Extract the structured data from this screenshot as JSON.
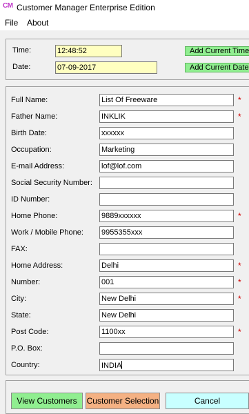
{
  "window": {
    "icon_text": "CM",
    "title": "Customer Manager Enterprise Edition"
  },
  "menu": {
    "file": "File",
    "about": "About"
  },
  "datetime": {
    "time_label": "Time:",
    "time_value": "12:48:52",
    "date_label": "Date:",
    "date_value": "07-09-2017",
    "add_time_button": "Add Current Time",
    "add_date_button": "Add Current Date"
  },
  "form": {
    "fields": [
      {
        "label": "Full Name:",
        "value": "List Of Freeware",
        "required": "*"
      },
      {
        "label": "Father Name:",
        "value": "INKLIK",
        "required": "*"
      },
      {
        "label": "Birth Date:",
        "value": "xxxxxx",
        "required": ""
      },
      {
        "label": "Occupation:",
        "value": "Marketing",
        "required": ""
      },
      {
        "label": "E-mail Address:",
        "value": "lof@lof.com",
        "required": ""
      },
      {
        "label": "Social Security Number:",
        "value": "",
        "required": ""
      },
      {
        "label": "ID Number:",
        "value": "",
        "required": ""
      },
      {
        "label": "Home Phone:",
        "value": "9889xxxxxx",
        "required": "*"
      },
      {
        "label": "Work / Mobile Phone:",
        "value": "9955355xxx",
        "required": ""
      },
      {
        "label": "FAX:",
        "value": "",
        "required": ""
      },
      {
        "label": "Home Address:",
        "value": "Delhi",
        "required": "*"
      },
      {
        "label": "Number:",
        "value": "001",
        "required": "*"
      },
      {
        "label": "City:",
        "value": "New Delhi",
        "required": "*"
      },
      {
        "label": "State:",
        "value": "New Delhi",
        "required": ""
      },
      {
        "label": "Post Code:",
        "value": "1100xx",
        "required": "*"
      },
      {
        "label": "P.O. Box:",
        "value": "",
        "required": ""
      },
      {
        "label": "Country:",
        "value": "INDIA",
        "required": ""
      }
    ]
  },
  "buttons": {
    "view_customers": "View Customers",
    "customer_selection": "Customer Selection",
    "cancel": "Cancel"
  },
  "colors": {
    "green_button": "#90ee90",
    "orange_button": "#f4b183",
    "cyan_button": "#c8ffff",
    "yellow_field": "#ffffc0",
    "required_mark": "#d00000"
  }
}
